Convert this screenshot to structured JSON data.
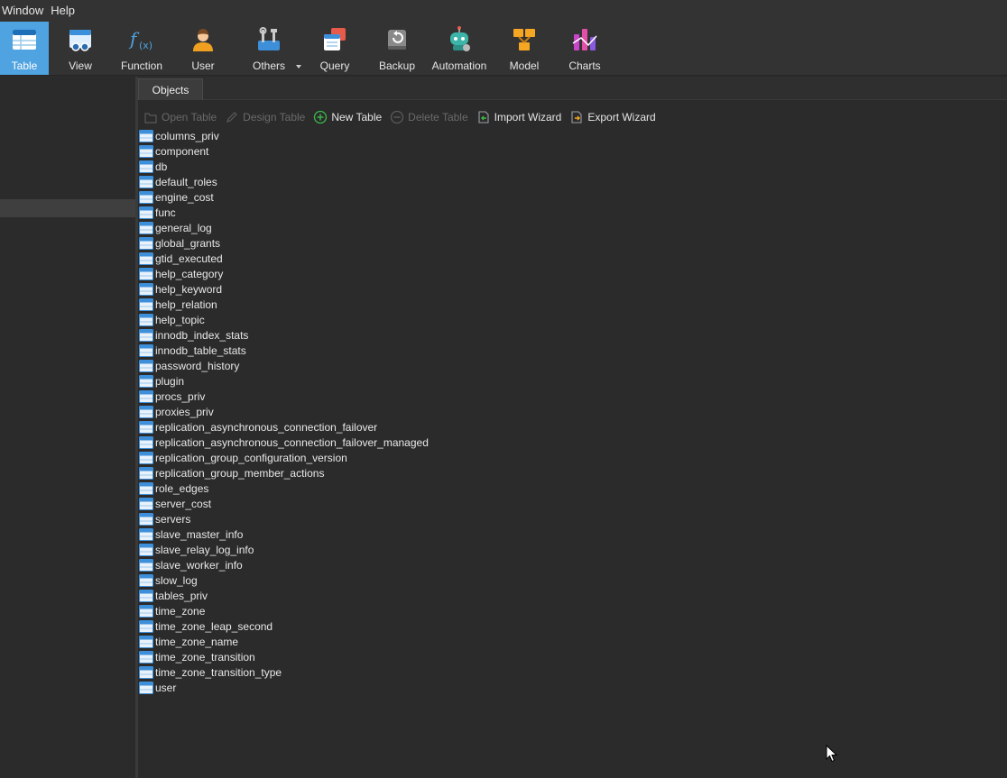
{
  "menubar": {
    "items": [
      "Window",
      "Help"
    ]
  },
  "ribbon": {
    "buttons": [
      {
        "label": "Table",
        "icon": "table-icon",
        "active": true
      },
      {
        "label": "View",
        "icon": "view-icon"
      },
      {
        "label": "Function",
        "icon": "function-icon"
      },
      {
        "label": "User",
        "icon": "user-icon"
      },
      {
        "label": "Others",
        "icon": "others-icon"
      },
      {
        "label": "Query",
        "icon": "query-icon"
      },
      {
        "label": "Backup",
        "icon": "backup-icon"
      },
      {
        "label": "Automation",
        "icon": "automation-icon"
      },
      {
        "label": "Model",
        "icon": "model-icon"
      },
      {
        "label": "Charts",
        "icon": "charts-icon"
      }
    ]
  },
  "tabs": {
    "objects": "Objects"
  },
  "toolbar": {
    "open_table": "Open Table",
    "design_table": "Design Table",
    "new_table": "New Table",
    "delete_table": "Delete Table",
    "import_wizard": "Import Wizard",
    "export_wizard": "Export Wizard"
  },
  "tables": [
    "columns_priv",
    "component",
    "db",
    "default_roles",
    "engine_cost",
    "func",
    "general_log",
    "global_grants",
    "gtid_executed",
    "help_category",
    "help_keyword",
    "help_relation",
    "help_topic",
    "innodb_index_stats",
    "innodb_table_stats",
    "password_history",
    "plugin",
    "procs_priv",
    "proxies_priv",
    "replication_asynchronous_connection_failover",
    "replication_asynchronous_connection_failover_managed",
    "replication_group_configuration_version",
    "replication_group_member_actions",
    "role_edges",
    "server_cost",
    "servers",
    "slave_master_info",
    "slave_relay_log_info",
    "slave_worker_info",
    "slow_log",
    "tables_priv",
    "time_zone",
    "time_zone_leap_second",
    "time_zone_name",
    "time_zone_transition",
    "time_zone_transition_type",
    "user"
  ],
  "colors": {
    "accent": "#4fa3e0",
    "background": "#2b2b2b",
    "toolbar": "#333333",
    "new_icon": "#3cb84a"
  }
}
